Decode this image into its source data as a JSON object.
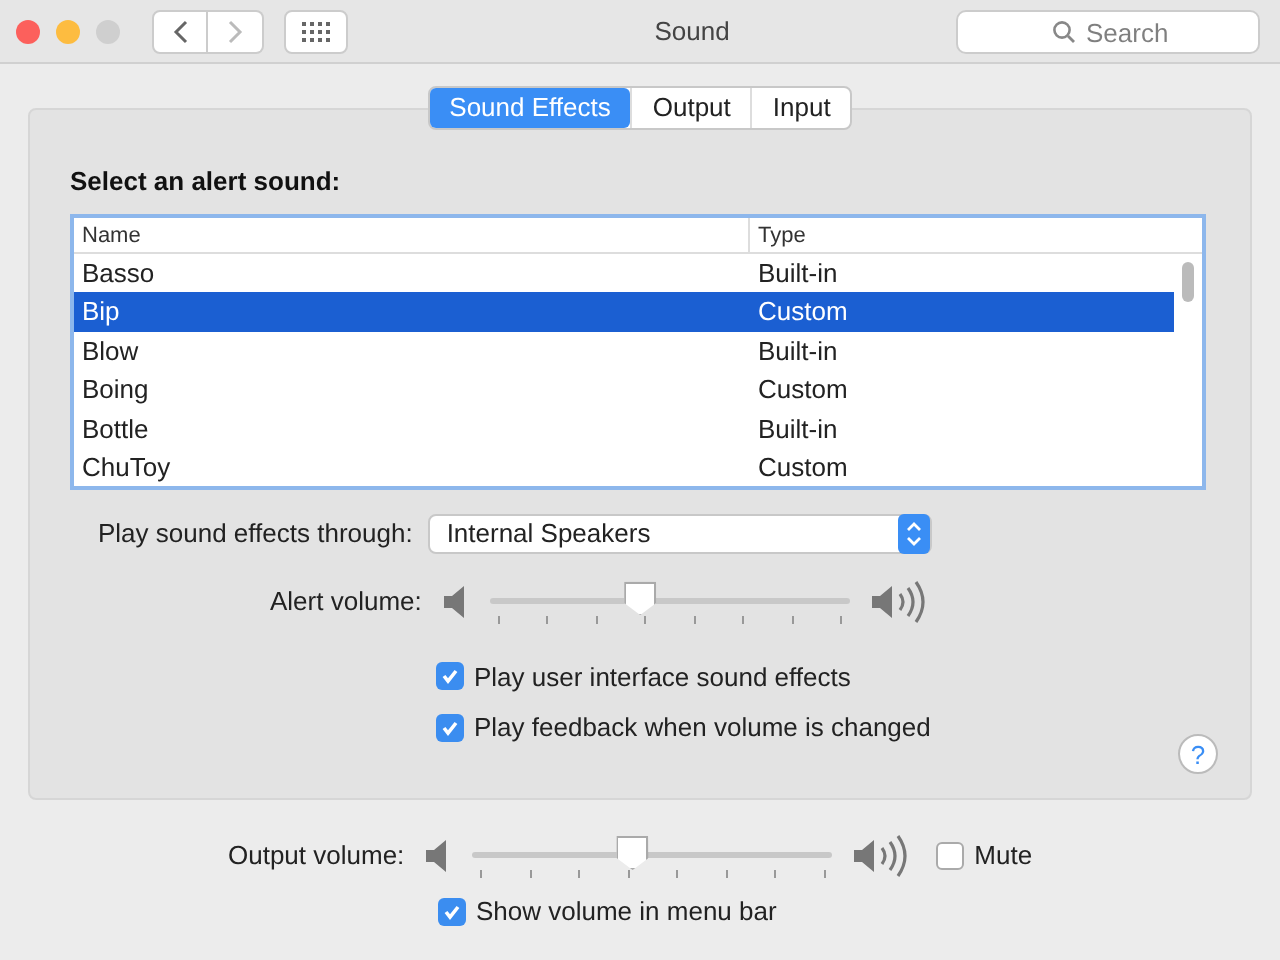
{
  "window": {
    "title": "Sound"
  },
  "search": {
    "placeholder": "Search"
  },
  "tabs": [
    {
      "label": "Sound Effects",
      "selected": true
    },
    {
      "label": "Output",
      "selected": false
    },
    {
      "label": "Input",
      "selected": false
    }
  ],
  "alert_heading": "Select an alert sound:",
  "table": {
    "columns": [
      "Name",
      "Type"
    ],
    "rows": [
      {
        "name": "Basso",
        "type": "Built-in",
        "selected": false
      },
      {
        "name": "Bip",
        "type": "Custom",
        "selected": true
      },
      {
        "name": "Blow",
        "type": "Built-in",
        "selected": false
      },
      {
        "name": "Boing",
        "type": "Custom",
        "selected": false
      },
      {
        "name": "Bottle",
        "type": "Built-in",
        "selected": false
      },
      {
        "name": "ChuToy",
        "type": "Custom",
        "selected": false
      }
    ]
  },
  "play_through": {
    "label": "Play sound effects through:",
    "value": "Internal Speakers"
  },
  "alert_volume": {
    "label": "Alert volume:",
    "level": 0.41
  },
  "effects_checks": [
    {
      "label": "Play user interface sound effects",
      "checked": true
    },
    {
      "label": "Play feedback when volume is changed",
      "checked": true
    }
  ],
  "help": "?",
  "output_volume": {
    "label": "Output volume:",
    "level": 0.44
  },
  "mute": {
    "label": "Mute",
    "checked": false
  },
  "menu_bar_check": {
    "label": "Show volume in menu bar",
    "checked": true
  }
}
